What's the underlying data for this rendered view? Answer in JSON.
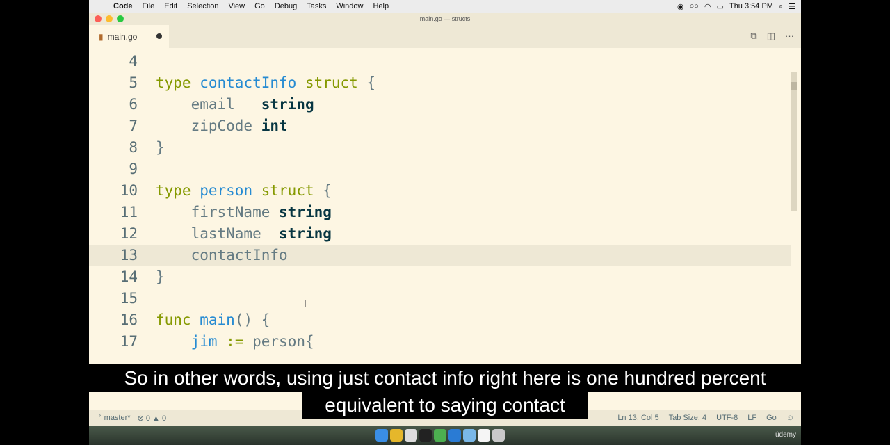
{
  "menubar": {
    "app": "Code",
    "items": [
      "File",
      "Edit",
      "Selection",
      "View",
      "Go",
      "Debug",
      "Tasks",
      "Window",
      "Help"
    ],
    "clock": "Thu 3:54 PM"
  },
  "window": {
    "title": "main.go — structs"
  },
  "tab": {
    "filename": "main.go"
  },
  "editor": {
    "lines": [
      {
        "num": "4"
      },
      {
        "num": "5"
      },
      {
        "num": "6"
      },
      {
        "num": "7"
      },
      {
        "num": "8"
      },
      {
        "num": "9"
      },
      {
        "num": "10"
      },
      {
        "num": "11"
      },
      {
        "num": "12"
      },
      {
        "num": "13"
      },
      {
        "num": "14"
      },
      {
        "num": "15"
      },
      {
        "num": "16"
      },
      {
        "num": "17"
      }
    ],
    "tokens": {
      "type": "type",
      "struct": "struct",
      "func": "func",
      "contactInfo": "contactInfo",
      "person": "person",
      "email": "email",
      "string": "string",
      "zipCode": "zipCode",
      "int": "int",
      "firstName": "firstName",
      "lastName": "lastName",
      "main": "main",
      "jim": "jim",
      "assign": ":=",
      "open_brace": "{",
      "close_brace": "}",
      "parens": "()",
      "person_open": "person{"
    }
  },
  "statusbar": {
    "branch": "master*",
    "errors": "0",
    "warnings": "0",
    "position": "Ln 13, Col 5",
    "tabsize": "Tab Size: 4",
    "encoding": "UTF-8",
    "eol": "LF",
    "language": "Go"
  },
  "subtitles": {
    "line1": "So in other words, using just contact info right here is one hundred percent",
    "line2": "equivalent to saying contact"
  },
  "watermark": "ûdemy",
  "colors": {
    "editor_bg": "#fdf6e3",
    "keyword": "#859900",
    "type_name": "#268bd2"
  }
}
